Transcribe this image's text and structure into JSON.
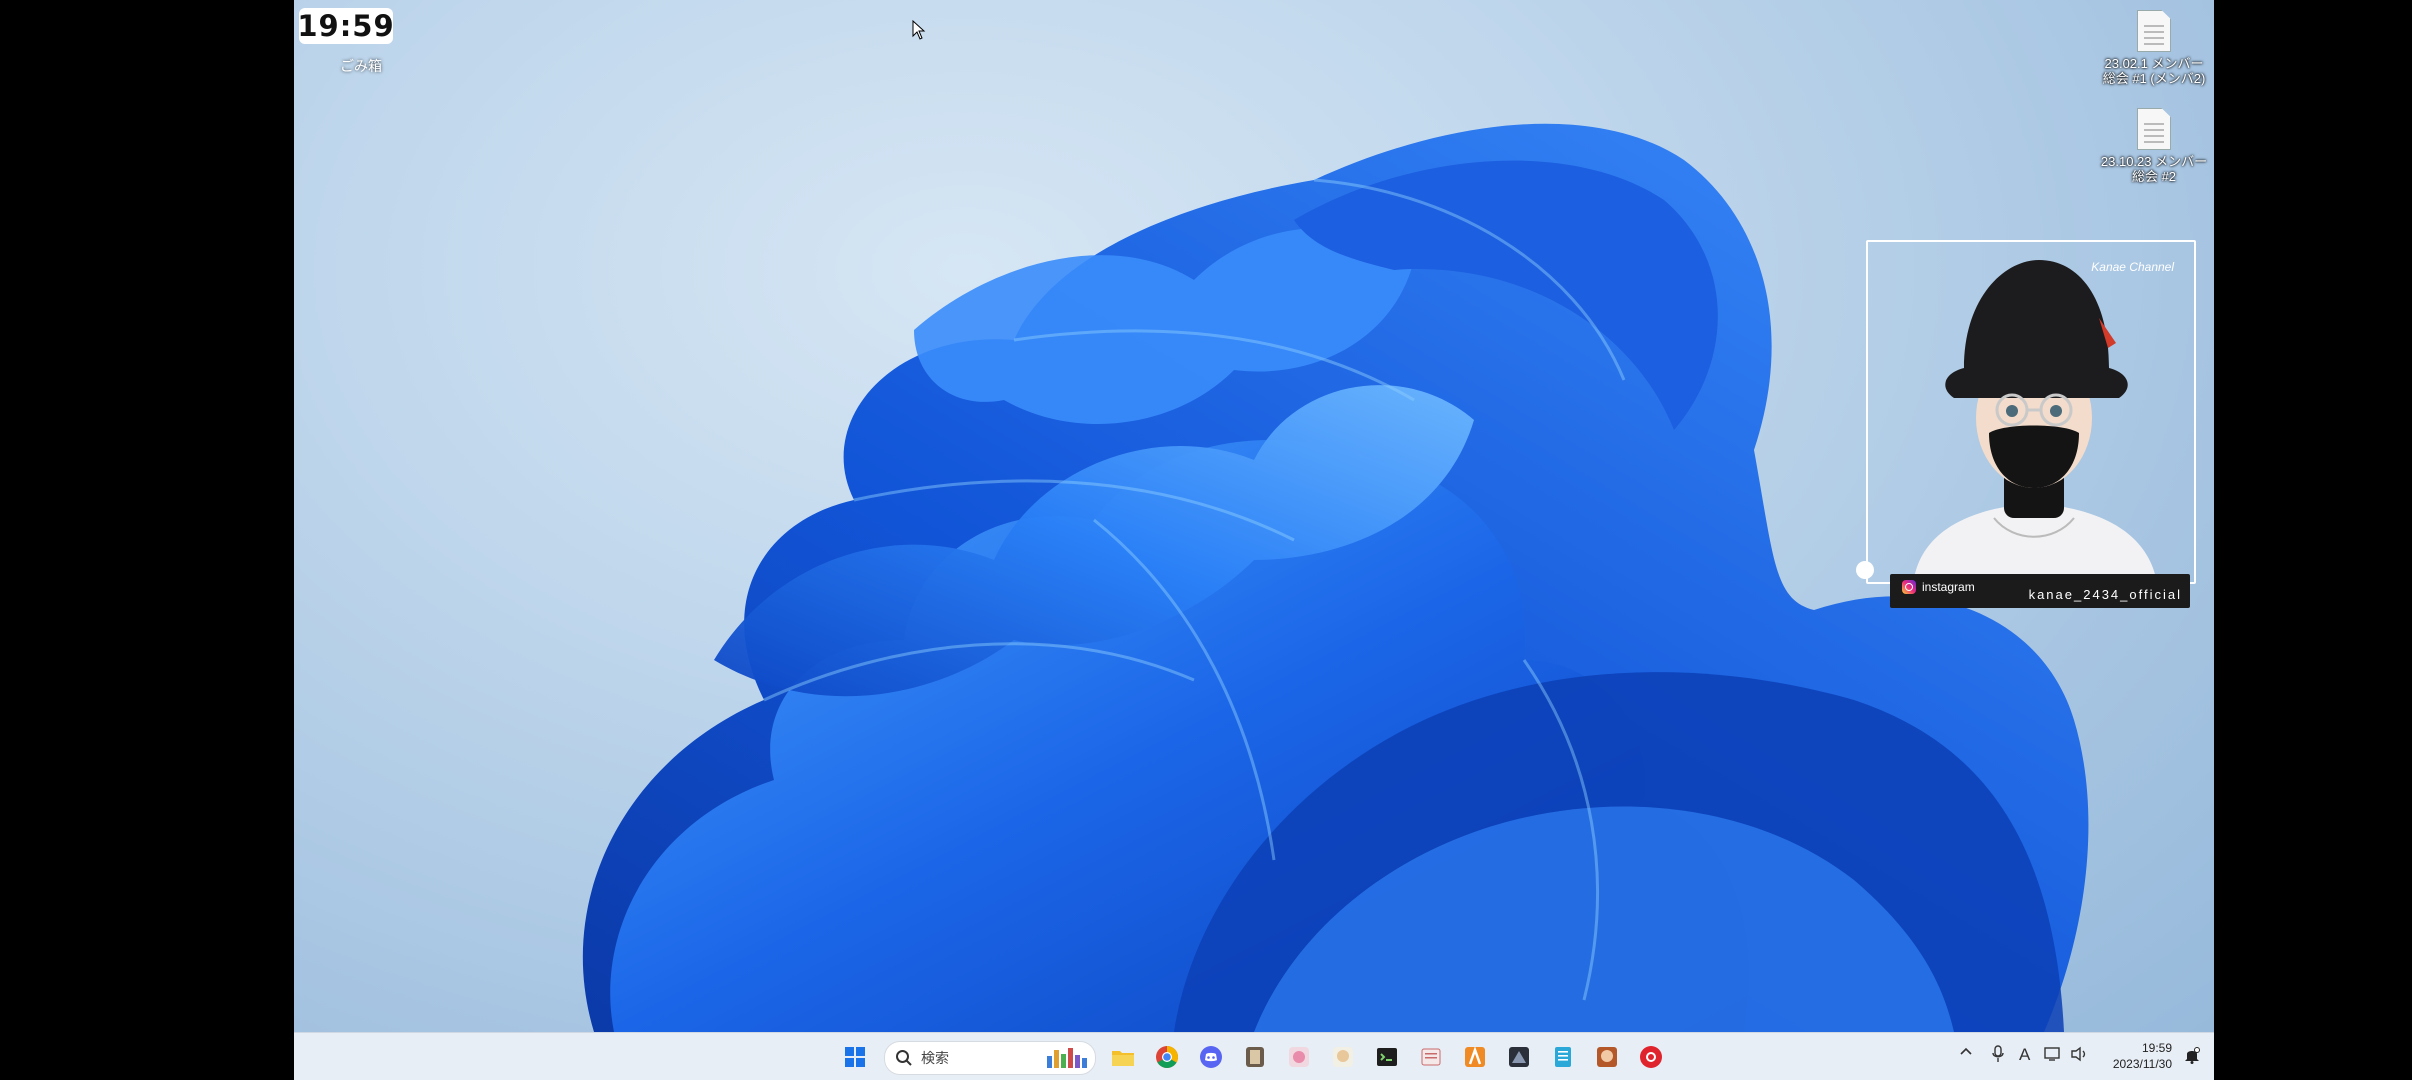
{
  "overlay": {
    "clock": "19:59"
  },
  "desktop": {
    "recycle_bin_label": "ごみ箱",
    "icons": [
      {
        "label": "23.02.1 メンバー総会 #1 (メンバ2)",
        "icon": "text-document-icon"
      },
      {
        "label": "23.10.23 メンバー総会 #2",
        "icon": "text-document-icon"
      }
    ]
  },
  "streamer": {
    "channel": "Kanae Channel",
    "social_label": "instagram",
    "handle": "kanae_2434_official"
  },
  "taskbar": {
    "search_placeholder": "検索",
    "apps": [
      "file-explorer-icon",
      "chrome-icon",
      "discord-icon",
      "app-icon-1",
      "app-icon-2",
      "app-icon-3",
      "terminal-icon",
      "notepad-icon",
      "app-icon-4",
      "game-icon",
      "document-icon",
      "game-icon-2",
      "record-icon"
    ],
    "time": "19:59",
    "date": "2023/11/30",
    "ime": "A"
  },
  "colors": {
    "wallpaper_blue": "#1f6fe6",
    "taskbar": "#e8eef5"
  }
}
